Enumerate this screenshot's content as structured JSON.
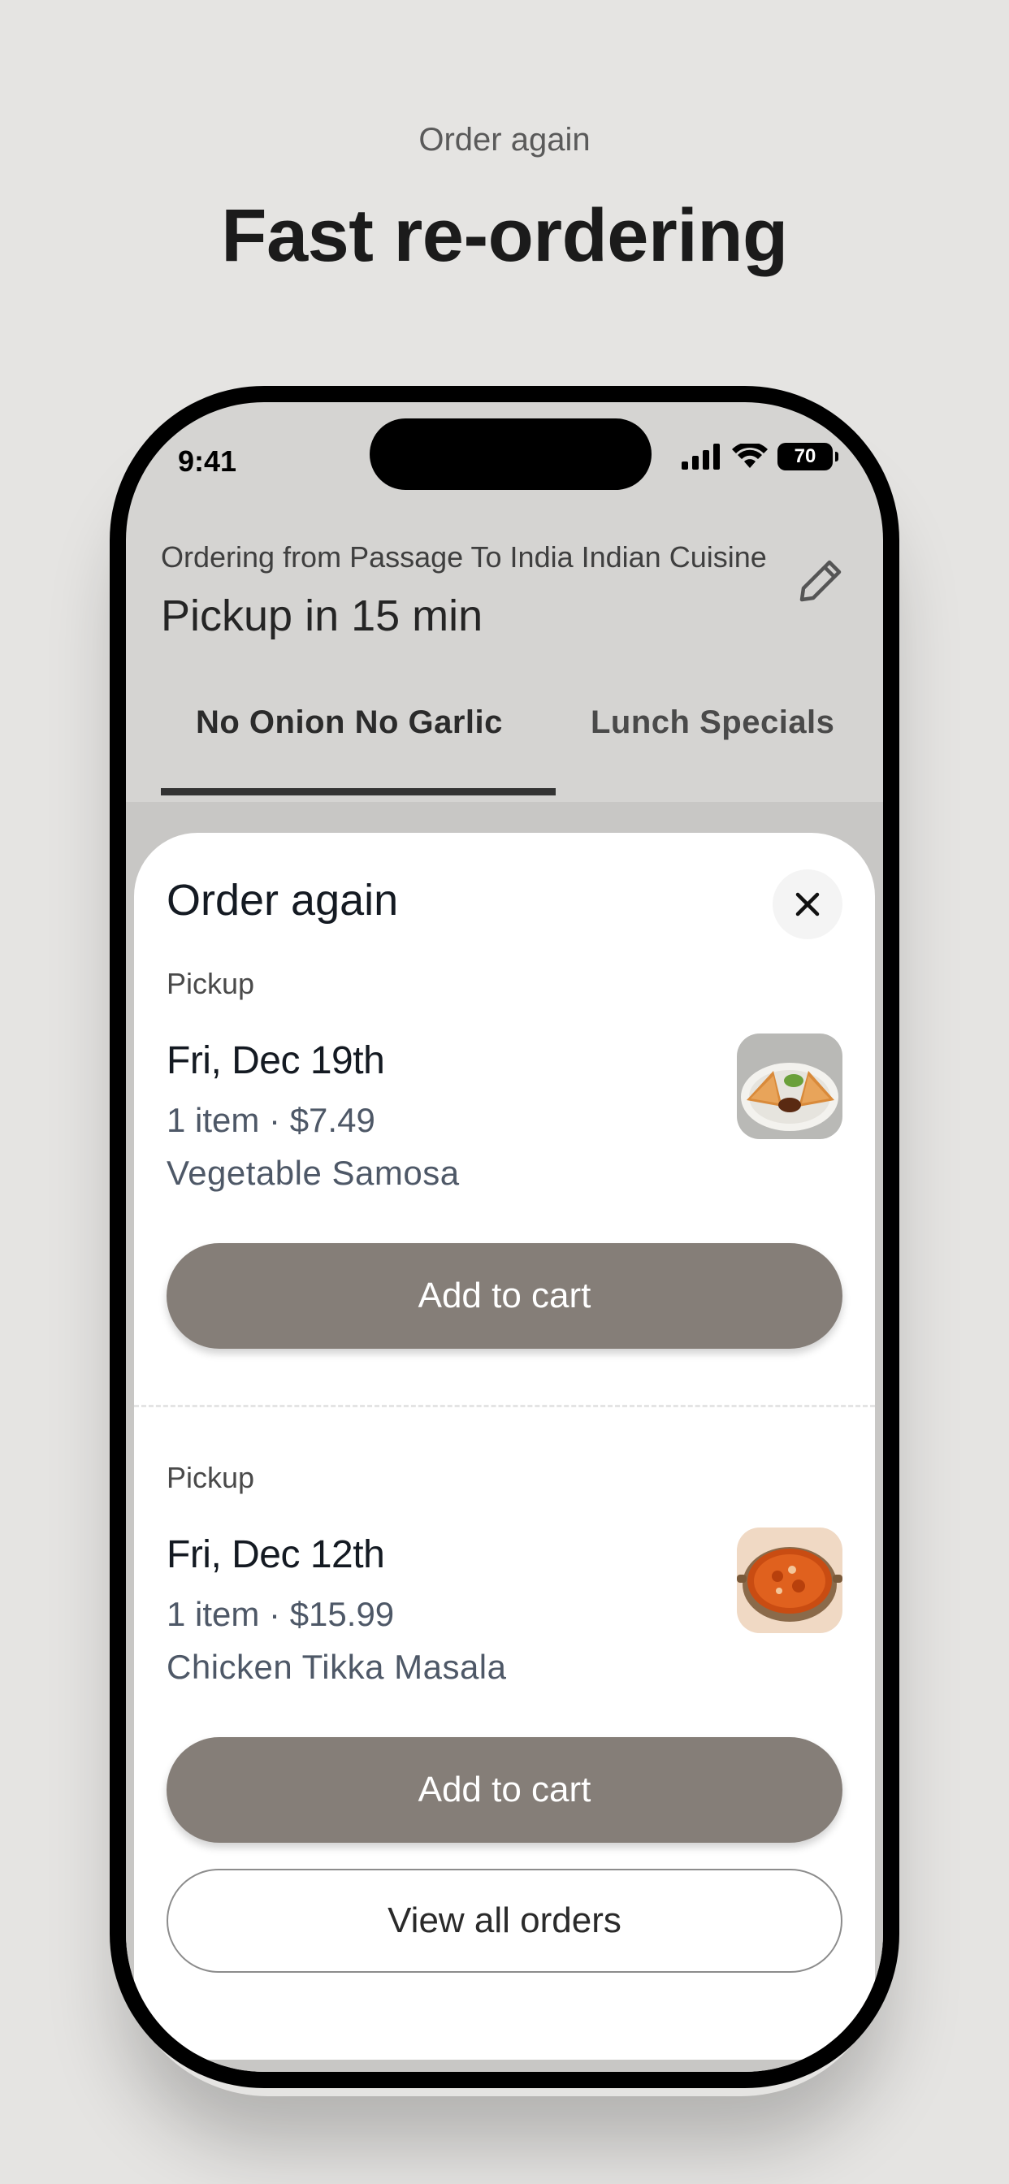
{
  "promo": {
    "eyebrow": "Order again",
    "headline": "Fast re-ordering"
  },
  "status_bar": {
    "time": "9:41",
    "battery": "70",
    "icons": [
      "signal-icon",
      "wifi-icon",
      "battery-icon"
    ]
  },
  "header": {
    "ordering_from": "Ordering from Passage To India Indian Cuisine",
    "pickup_time": "Pickup in 15 min",
    "edit_icon": "pencil-icon"
  },
  "tabs": [
    {
      "label": "No Onion No Garlic",
      "active": true
    },
    {
      "label": "Lunch Specials",
      "active": false
    }
  ],
  "sheet": {
    "title": "Order again",
    "close_icon": "close-icon",
    "orders": [
      {
        "type": "Pickup",
        "date": "Fri, Dec 19th",
        "meta": "1 item · $7.49",
        "item": "Vegetable Samosa",
        "image": "samosa-image",
        "add_label": "Add to cart"
      },
      {
        "type": "Pickup",
        "date": "Fri, Dec 12th",
        "meta": "1 item · $15.99",
        "item": "Chicken Tikka Masala",
        "image": "tikka-masala-image",
        "add_label": "Add to cart"
      }
    ],
    "view_all_label": "View all orders"
  },
  "colors": {
    "background": "#e5e4e2",
    "primary_button": "#857e78",
    "text_dark": "#141a22",
    "text_muted": "#4e5867"
  }
}
